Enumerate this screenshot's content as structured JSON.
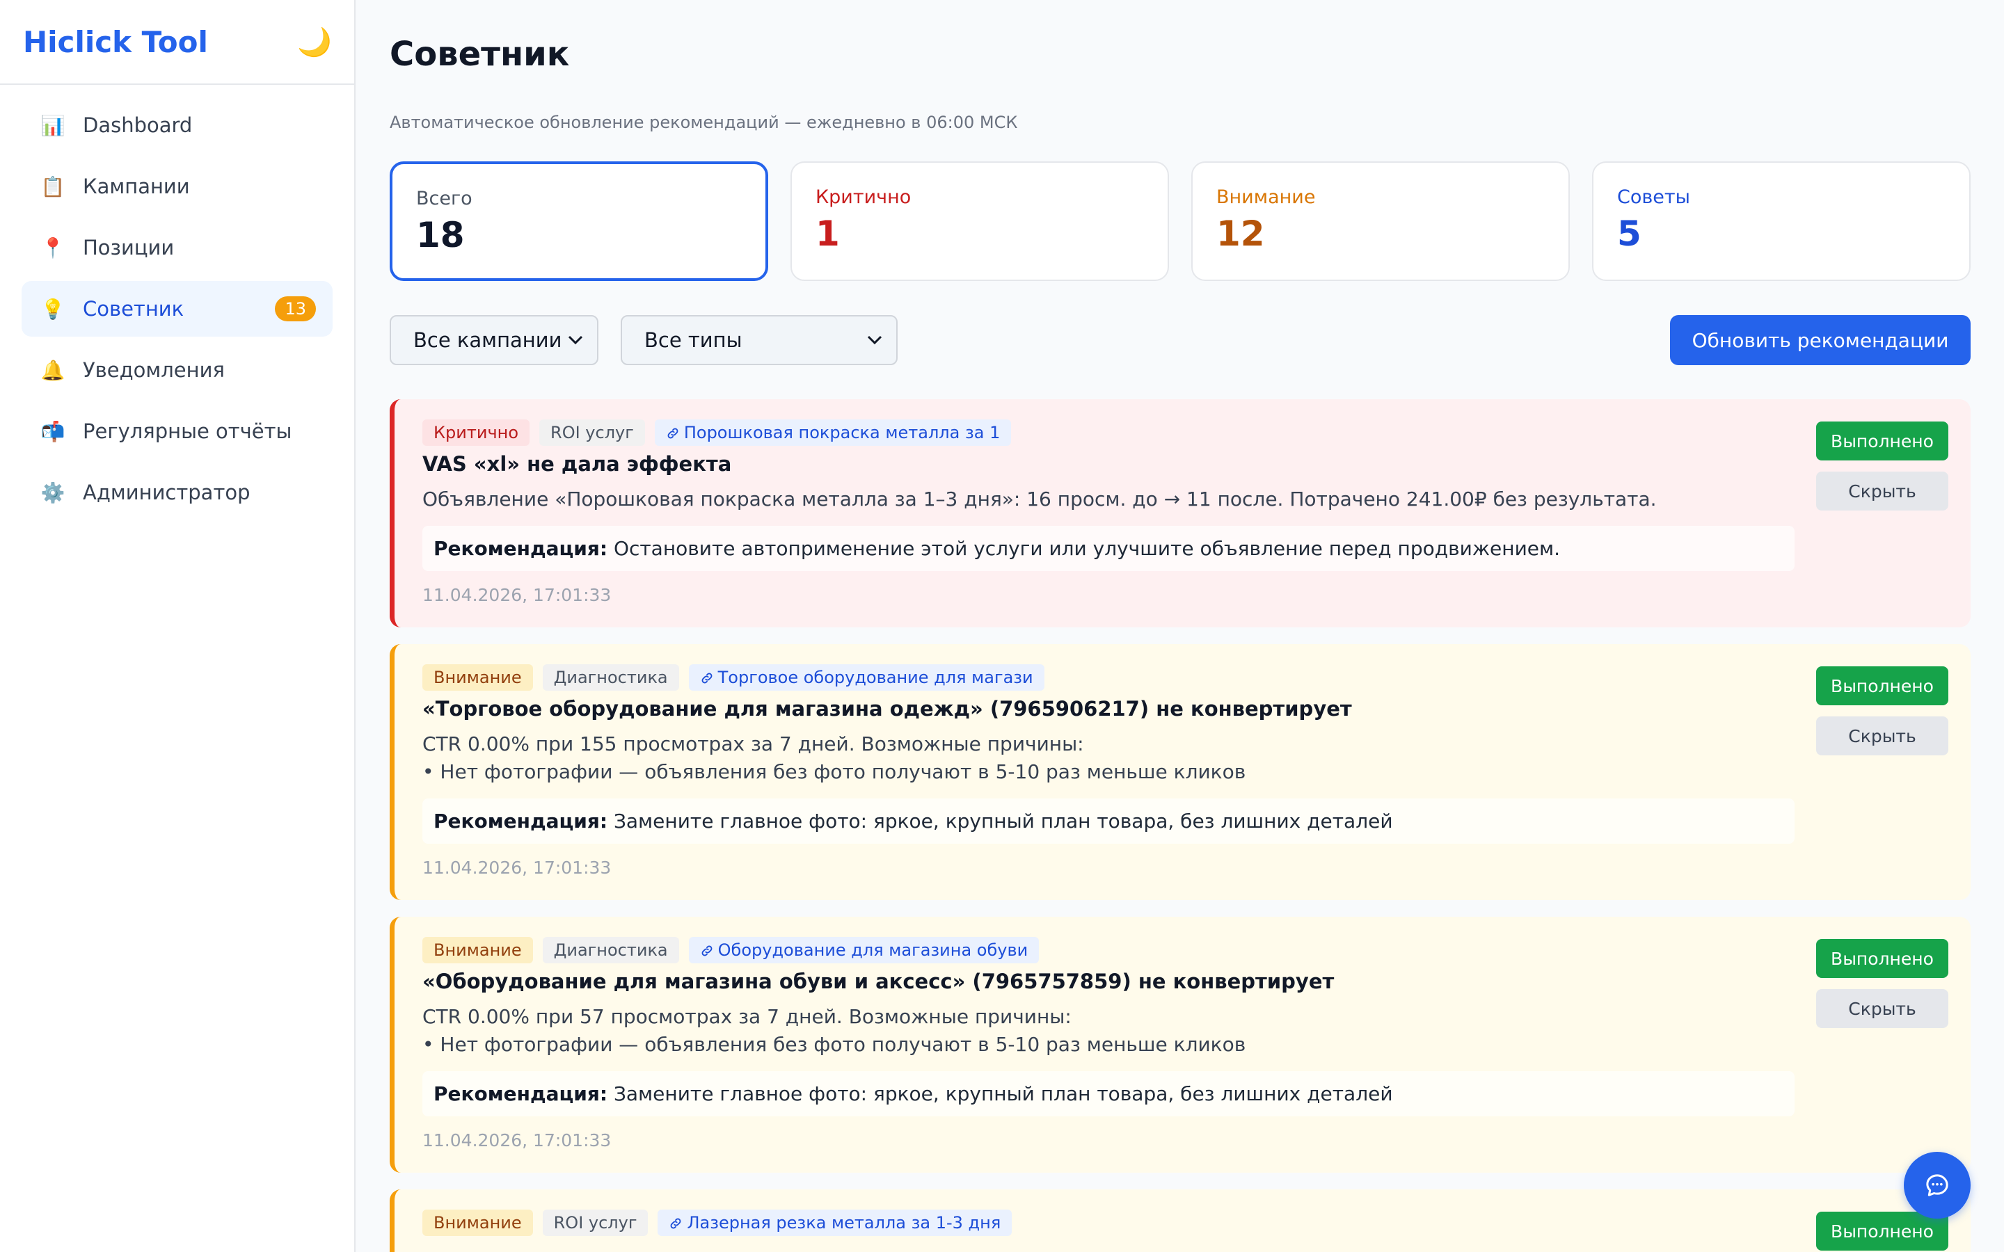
{
  "sidebar": {
    "brand": "Hiclick Tool",
    "theme_icon": "🌙",
    "items": [
      {
        "icon": "📊",
        "label": "Dashboard"
      },
      {
        "icon": "📋",
        "label": "Кампании"
      },
      {
        "icon": "📍",
        "label": "Позиции"
      },
      {
        "icon": "💡",
        "label": "Советник",
        "badge": "13"
      },
      {
        "icon": "🔔",
        "label": "Уведомления"
      },
      {
        "icon": "📬",
        "label": "Регулярные отчёты"
      },
      {
        "icon": "⚙️",
        "label": "Администратор"
      }
    ]
  },
  "header": {
    "title": "Советник",
    "subtitle": "Автоматическое обновление рекомендаций — ежедневно в 06:00 МСК"
  },
  "stats": [
    {
      "label": "Всего",
      "value": "18"
    },
    {
      "label": "Критично",
      "value": "1"
    },
    {
      "label": "Внимание",
      "value": "12"
    },
    {
      "label": "Советы",
      "value": "5"
    }
  ],
  "filters": {
    "campaigns": "Все кампании",
    "types": "Все типы",
    "refresh_label": "Обновить рекомендации"
  },
  "cards": [
    {
      "severity": "Критично",
      "type": "ROI услуг",
      "link": "Порошковая покраска металла за 1",
      "title": "VAS «xl» не дала эффекта",
      "description": "Объявление «Порошковая покраска металла за 1–3 дня»: 16 просм. до → 11 после. Потрачено 241.00₽ без результата.",
      "rec_label": "Рекомендация:",
      "rec_text": "Остановите автоприменение этой услуги или улучшите объявление перед продвижением.",
      "time": "11.04.2026, 17:01:33"
    },
    {
      "severity": "Внимание",
      "type": "Диагностика",
      "link": "Торговое оборудование для магази",
      "title": "«Торговое оборудование для магазина одежд» (7965906217) не конвертирует",
      "description": "CTR 0.00% при 155 просмотрах за 7 дней. Возможные причины:\n• Нет фотографии — объявления без фото получают в 5-10 раз меньше кликов",
      "rec_label": "Рекомендация:",
      "rec_text": "Замените главное фото: яркое, крупный план товара, без лишних деталей",
      "time": "11.04.2026, 17:01:33"
    },
    {
      "severity": "Внимание",
      "type": "Диагностика",
      "link": "Оборудование для магазина обуви",
      "title": "«Оборудование для магазина обуви и аксесс» (7965757859) не конвертирует",
      "description": "CTR 0.00% при 57 просмотрах за 7 дней. Возможные причины:\n• Нет фотографии — объявления без фото получают в 5-10 раз меньше кликов",
      "rec_label": "Рекомендация:",
      "rec_text": "Замените главное фото: яркое, крупный план товара, без лишних деталей",
      "time": "11.04.2026, 17:01:33"
    },
    {
      "severity": "Внимание",
      "type": "ROI услуг",
      "link": "Лазерная резка металла за 1-3 дня"
    }
  ],
  "actions": {
    "done_label": "Выполнено",
    "hide_label": "Скрыть"
  }
}
